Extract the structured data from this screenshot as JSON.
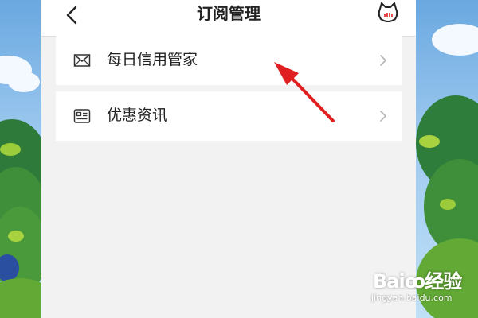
{
  "header": {
    "title": "订阅管理",
    "back_icon": "chevron-left-icon",
    "right_icon": "cat-face-icon"
  },
  "subscriptions": [
    {
      "icon": "envelope-icon",
      "label": "每日信用管家",
      "chevron": "chevron-right-icon"
    },
    {
      "icon": "newspaper-icon",
      "label": "优惠资讯",
      "chevron": "chevron-right-icon"
    }
  ],
  "annotation": {
    "icon": "red-arrow-icon",
    "color": "#e02020"
  },
  "watermark": {
    "brand": "Bai",
    "brand_suffix": "经验",
    "url": "jingyan.baidu.com"
  },
  "colors": {
    "header_bg": "#ffffff",
    "page_bg": "#f2f2f2",
    "text": "#222222",
    "accent_red": "#e02020"
  }
}
